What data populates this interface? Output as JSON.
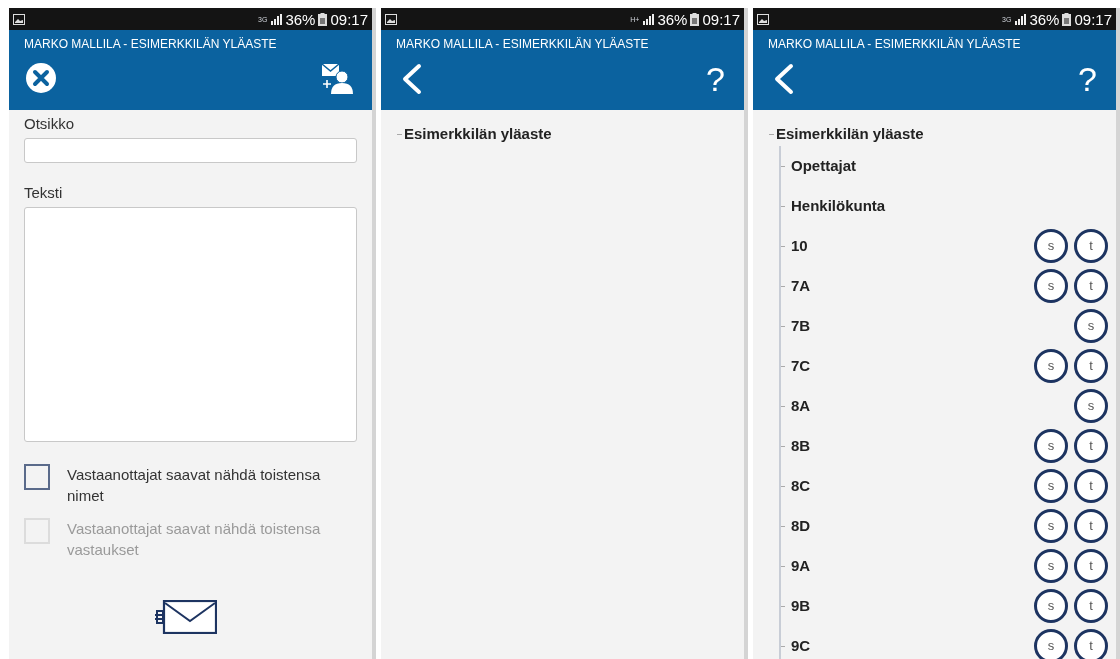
{
  "screens": [
    {
      "kind": "compose",
      "status_bar": {
        "network": "3G",
        "battery": "36%",
        "time": "09:17"
      },
      "header": {
        "title": "MARKO MALLILA - ESIMERKKILÄN YLÄASTE"
      },
      "fields": [
        {
          "label": "Otsikko",
          "kind": "line"
        },
        {
          "label": "Teksti",
          "kind": "area"
        }
      ],
      "checkboxes": [
        {
          "label": "Vastaanottajat saavat nähdä toistensa nimet",
          "checked": false,
          "disabled": false
        },
        {
          "label": "Vastaanottajat saavat nähdä toistensa vastaukset",
          "checked": false,
          "disabled": true
        }
      ]
    },
    {
      "kind": "tree",
      "status_bar": {
        "network": "H+",
        "battery": "36%",
        "time": "09:17"
      },
      "header": {
        "title": "MARKO MALLILA - ESIMERKKILÄN YLÄASTE",
        "help": "?"
      },
      "tree": [
        {
          "label": "Esimerkkilän yläaste"
        }
      ]
    },
    {
      "kind": "tree",
      "status_bar": {
        "network": "3G",
        "battery": "36%",
        "time": "09:17"
      },
      "header": {
        "title": "MARKO MALLILA - ESIMERKKILÄN YLÄASTE",
        "help": "?"
      },
      "tree": [
        {
          "label": "Esimerkkilän yläaste",
          "children": [
            {
              "label": "Opettajat"
            },
            {
              "label": "Henkilökunta"
            },
            {
              "label": "10",
              "badges": [
                "s",
                "t"
              ]
            },
            {
              "label": "7A",
              "badges": [
                "s",
                "t"
              ]
            },
            {
              "label": "7B",
              "badges": [
                "s"
              ]
            },
            {
              "label": "7C",
              "badges": [
                "s",
                "t"
              ]
            },
            {
              "label": "8A",
              "badges": [
                "s"
              ]
            },
            {
              "label": "8B",
              "badges": [
                "s",
                "t"
              ]
            },
            {
              "label": "8C",
              "badges": [
                "s",
                "t"
              ]
            },
            {
              "label": "8D",
              "badges": [
                "s",
                "t"
              ]
            },
            {
              "label": "9A",
              "badges": [
                "s",
                "t"
              ]
            },
            {
              "label": "9B",
              "badges": [
                "s",
                "t"
              ]
            },
            {
              "label": "9C",
              "badges": [
                "s",
                "t"
              ]
            }
          ]
        }
      ]
    }
  ]
}
